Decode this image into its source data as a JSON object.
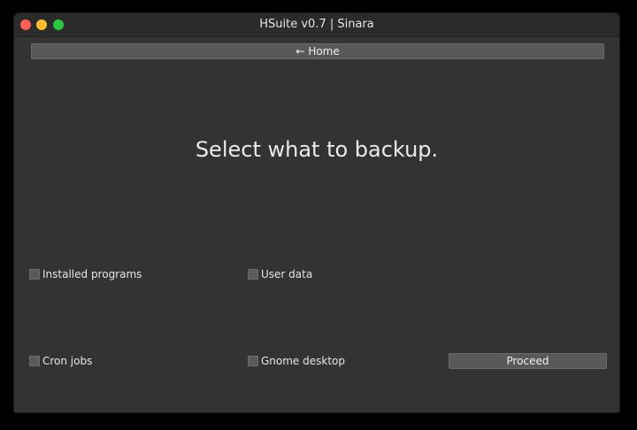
{
  "window": {
    "title": "HSuite v0.7 | Sinara"
  },
  "nav": {
    "home_label": "Home",
    "home_icon": "arrow-left-icon"
  },
  "main": {
    "heading": "Select what to backup.",
    "options": [
      {
        "label": "Installed programs",
        "checked": false
      },
      {
        "label": "User data",
        "checked": false
      },
      {
        "label": "Cron jobs",
        "checked": false
      },
      {
        "label": "Gnome desktop",
        "checked": false
      }
    ],
    "proceed_label": "Proceed"
  },
  "colors": {
    "window_bg": "#333333",
    "titlebar_bg": "#2b2b2b",
    "button_bg": "#595959",
    "close": "#fe5f57",
    "minimize": "#febc2e",
    "maximize": "#28c840"
  }
}
